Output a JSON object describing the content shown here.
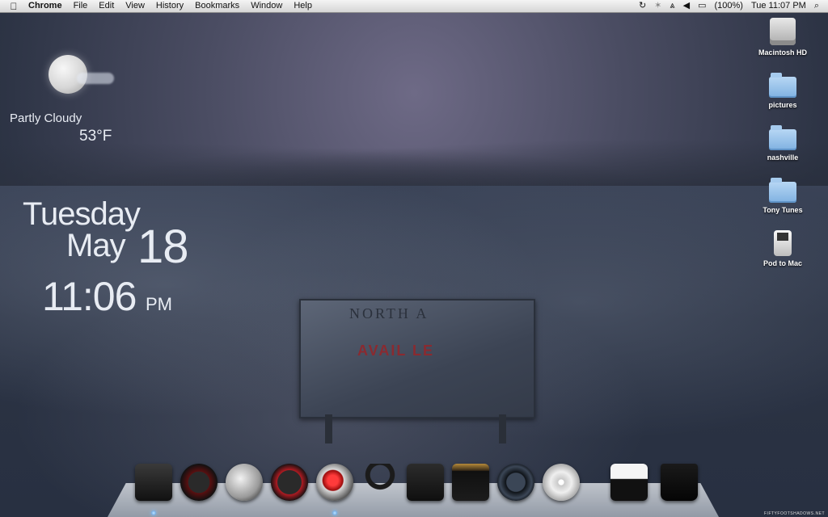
{
  "menubar": {
    "app_name": "Chrome",
    "menus": [
      "File",
      "Edit",
      "View",
      "History",
      "Bookmarks",
      "Window",
      "Help"
    ],
    "status": {
      "time_machine_icon": "time-machine-icon",
      "bluetooth_icon": "bluetooth-icon",
      "wifi_icon": "wifi-icon",
      "volume_icon": "volume-icon",
      "battery_percent": "(100%)",
      "clock": "Tue 11:07 PM",
      "spotlight_icon": "spotlight-search-icon"
    }
  },
  "weather": {
    "condition": "Partly Cloudy",
    "temperature": "53°F",
    "icon": "moon-cloud-icon"
  },
  "clock_widget": {
    "day": "Tuesday",
    "month": "May",
    "date": "18",
    "time": "11:06",
    "ampm": "PM"
  },
  "billboard": {
    "line1": "NORTH A",
    "line2": "AVAIL    LE",
    "line3": "         ",
    "colors": {
      "surface": "#4a5262",
      "accent_text": "#8a2a30"
    }
  },
  "desktop_icons": [
    {
      "label": "Macintosh HD",
      "icon": "hard-drive-icon"
    },
    {
      "label": "pictures",
      "icon": "folder-icon"
    },
    {
      "label": "nashville",
      "icon": "folder-icon"
    },
    {
      "label": "Tony Tunes",
      "icon": "folder-icon"
    },
    {
      "label": "Pod to Mac",
      "icon": "ipod-icon"
    }
  ],
  "dock": {
    "items": [
      {
        "name": "finder",
        "icon": "finder-icon"
      },
      {
        "name": "dashboard",
        "icon": "dashboard-icon"
      },
      {
        "name": "firefox",
        "icon": "firefox-icon"
      },
      {
        "name": "safari",
        "icon": "safari-compass-icon"
      },
      {
        "name": "chrome",
        "icon": "chrome-icon"
      },
      {
        "name": "headphones",
        "icon": "headphones-icon"
      },
      {
        "name": "iphoto",
        "icon": "camera-icon"
      },
      {
        "name": "amp",
        "icon": "amplifier-icon"
      },
      {
        "name": "time-machine",
        "icon": "time-machine-icon"
      },
      {
        "name": "dvd-player",
        "icon": "dvd-player-icon"
      },
      {
        "name": "downloads-stack",
        "icon": "stack-icon"
      },
      {
        "name": "trash",
        "icon": "trash-icon"
      }
    ]
  },
  "credit": "FIFTYFOOTSHADOWS.NET"
}
